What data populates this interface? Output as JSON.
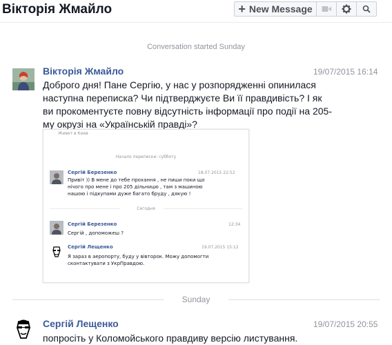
{
  "header": {
    "title": "Вікторія Жмайло",
    "new_message_label": "New Message"
  },
  "dividers": {
    "started": "Conversation started Sunday",
    "sunday": "Sunday"
  },
  "messages": [
    {
      "sender": "Вікторія Жмайло",
      "timestamp": "19/07/2015 16:14",
      "lines": [
        "Доброго дня! Пане Сергію, у нас у розпорядженні опинилася",
        "наступна переписка? Чи підтверджуєте Ви її правдивість? І як",
        "ви прокоментуєте повну відсутність інформації про події на 205-",
        "му окрузі на «Українській правді»?"
      ]
    },
    {
      "sender": "Сергій Лещенко",
      "timestamp": "19/07/2015 20:55",
      "lines": [
        "попросіть у Коломойського правдиву версію листування."
      ]
    }
  ],
  "attachment": {
    "top_text": "Живет в Киев",
    "started_label": "Начало переписки: субботу",
    "today_label": "Сегодня",
    "items": [
      {
        "name": "Сергій Березенко",
        "time": "18.07.2015 22:52",
        "lines": [
          "Привіт )) В мене до тебе прохання , не пиши поки  що",
          "нічого про мене і про 205 дільницю , там з машиною",
          "нашою і підкупами дуже багато бруду , дякую !"
        ]
      },
      {
        "name": "Сергій Березенко",
        "time": "12:34",
        "lines": [
          "Сергій , допоможеш ?"
        ]
      },
      {
        "name": "Сергій Лещенко",
        "time": "19.07.2015 15:12",
        "lines": [
          "Я зараз в аеропорту, буду у вівторок. Можу допомогти",
          "сконтактувати з УкрПравдою."
        ]
      }
    ]
  },
  "colors": {
    "link": "#3b5998",
    "meta": "#90949c",
    "text": "#141823"
  },
  "icons": [
    "plus-icon",
    "video-icon",
    "gear-icon",
    "search-icon"
  ]
}
